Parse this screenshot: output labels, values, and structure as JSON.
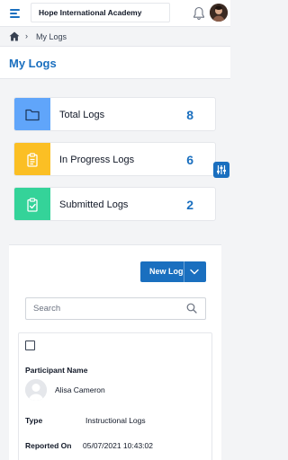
{
  "header": {
    "school_name": "Hope International Academy",
    "icons": [
      "hamburger-menu-icon",
      "bell-icon",
      "user-avatar"
    ]
  },
  "breadcrumb": {
    "home_icon": "home-icon",
    "separator_icon": "chevron-right-icon",
    "current": "My Logs"
  },
  "page": {
    "title": "My Logs"
  },
  "stats": [
    {
      "label": "Total Logs",
      "count": "8",
      "icon": "folder-icon",
      "color": "#60a5fa"
    },
    {
      "label": "In Progress Logs",
      "count": "6",
      "icon": "clipboard-list-icon",
      "color": "#fbbf24"
    },
    {
      "label": "Submitted Logs",
      "count": "2",
      "icon": "clipboard-check-icon",
      "color": "#34d399"
    }
  ],
  "filter_button": {
    "icon": "sliders-icon"
  },
  "toolbar": {
    "new_log_label": "New Log",
    "new_log_dropdown_icon": "chevron-down-icon"
  },
  "search": {
    "placeholder": "Search",
    "value": ""
  },
  "log_card": {
    "participant_label": "Participant Name",
    "participant_name": "Alisa Cameron",
    "type_label": "Type",
    "type_value": "Instructional Logs",
    "reported_label": "Reported On",
    "reported_value": "05/07/2021 10:43:02"
  },
  "colors": {
    "primary": "#1a6fbf",
    "total": "#60a5fa",
    "in_progress": "#fbbf24",
    "submitted": "#34d399"
  }
}
